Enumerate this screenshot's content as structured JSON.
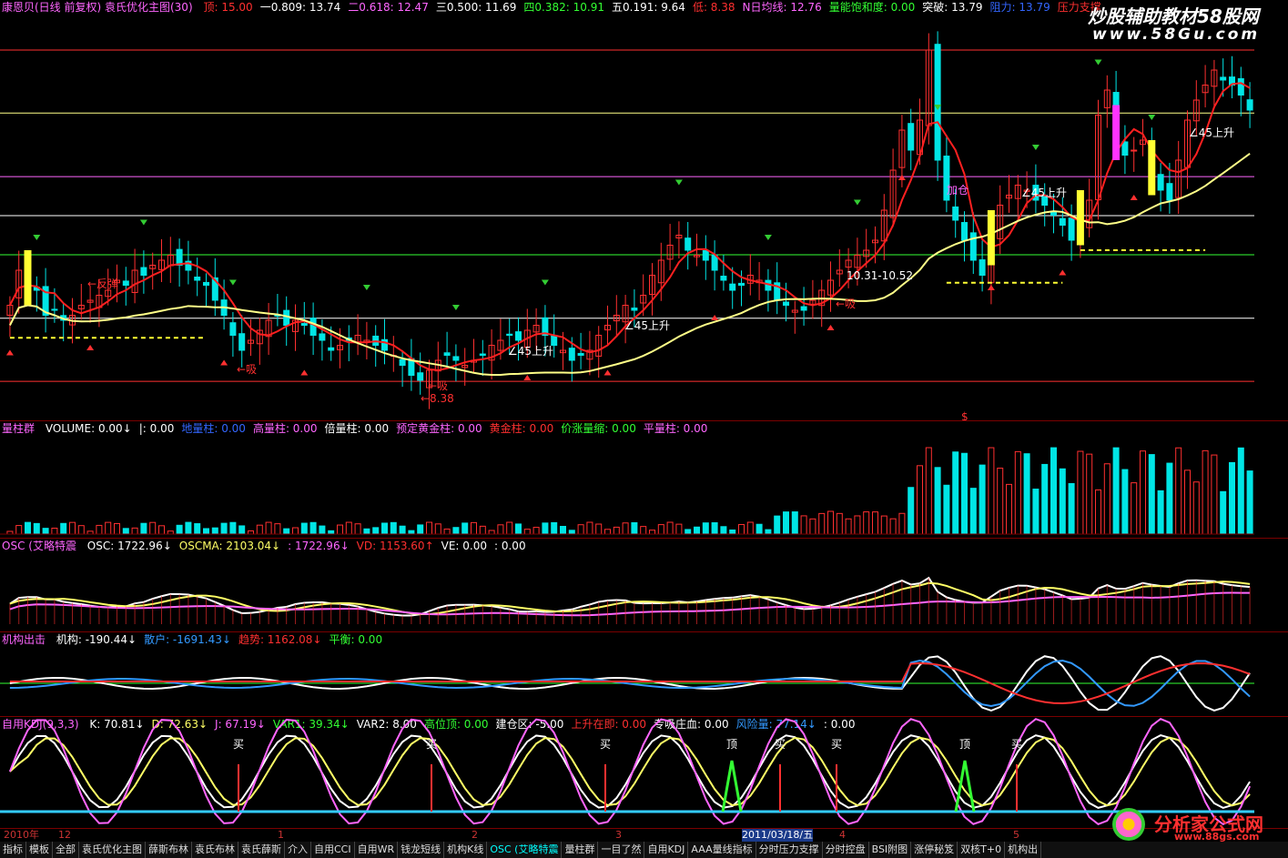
{
  "main_header": {
    "title": "康恩贝(日线 前复权) 袁氏优化主图(30)",
    "items": [
      {
        "t": "顶: 15.00",
        "c": "#ff3030"
      },
      {
        "t": "一0.809: 13.74",
        "c": "#ffffff"
      },
      {
        "t": "二0.618: 12.47",
        "c": "#ff66ff"
      },
      {
        "t": "三0.500: 11.69",
        "c": "#ffffff"
      },
      {
        "t": "四0.382: 10.91",
        "c": "#33ff33"
      },
      {
        "t": "五0.191: 9.64",
        "c": "#ffffff"
      },
      {
        "t": "低: 8.38",
        "c": "#ff3030"
      },
      {
        "t": "N日均线: 12.76",
        "c": "#ff66ff"
      },
      {
        "t": "量能饱和度: 0.00",
        "c": "#33ff33"
      },
      {
        "t": "突破: 13.79",
        "c": "#ffffff"
      },
      {
        "t": "阻力: 13.79",
        "c": "#3366ff"
      },
      {
        "t": "压力支撑",
        "c": "#ff3030"
      }
    ]
  },
  "watermarks": {
    "top": "炒股辅助教材58股网",
    "top_url": "www.58Gu.com",
    "bottom": "分析家公式网",
    "bottom_url": "www.88gs.com"
  },
  "price_labels": {
    "fanstan": "←反弹",
    "xi": "←吸",
    "xi2": "←吸",
    "xi3": "←吸",
    "low": "←8.38",
    "up45": "∠45上升",
    "jiacang": "加仓",
    "fib": "10.31-10.52",
    "dollar": "$"
  },
  "vol_header": {
    "title": "量柱群",
    "items": [
      {
        "t": "VOLUME: 0.00↓",
        "c": "#ffffff"
      },
      {
        "t": "|: 0.00",
        "c": "#ffffff"
      },
      {
        "t": "地量柱: 0.00",
        "c": "#3366ff"
      },
      {
        "t": "高量柱: 0.00",
        "c": "#ff66ff"
      },
      {
        "t": "倍量柱: 0.00",
        "c": "#ffffff"
      },
      {
        "t": "预定黄金柱: 0.00",
        "c": "#ff66ff"
      },
      {
        "t": "黄金柱: 0.00",
        "c": "#ff3030"
      },
      {
        "t": "价涨量缩: 0.00",
        "c": "#33ff33"
      },
      {
        "t": "平量柱: 0.00",
        "c": "#ff66ff"
      }
    ]
  },
  "osc_header": {
    "title": "OSC (艾略特震",
    "items": [
      {
        "t": "OSC: 1722.96↓",
        "c": "#ffffff"
      },
      {
        "t": "OSCMA: 2103.04↓",
        "c": "#ffff66"
      },
      {
        "t": ": 1722.96↓",
        "c": "#ff66ff"
      },
      {
        "t": "VD: 1153.60↑",
        "c": "#ff3030"
      },
      {
        "t": "VE: 0.00",
        "c": "#ffffff"
      },
      {
        "t": ": 0.00",
        "c": "#ffffff"
      }
    ]
  },
  "jg_header": {
    "title": "机构出击",
    "items": [
      {
        "t": "机构: -190.44↓",
        "c": "#ffffff"
      },
      {
        "t": "散户: -1691.43↓",
        "c": "#3399ff"
      },
      {
        "t": "趋势: 1162.08↓",
        "c": "#ff3030"
      },
      {
        "t": "平衡: 0.00",
        "c": "#33ff33"
      }
    ]
  },
  "kdj_header": {
    "title": "自用KDJ(9,3,3)",
    "items": [
      {
        "t": "K: 70.81↓",
        "c": "#ffffff"
      },
      {
        "t": "D: 72.63↓",
        "c": "#ffff66"
      },
      {
        "t": "J: 67.19↓",
        "c": "#ff66ff"
      },
      {
        "t": "VAR1: 39.34↓",
        "c": "#33ff33"
      },
      {
        "t": "VAR2: 8.00",
        "c": "#ffffff"
      },
      {
        "t": "高位顶: 0.00",
        "c": "#33ff33"
      },
      {
        "t": "建仓区: -5.00",
        "c": "#ffffff"
      },
      {
        "t": "上升在即: 0.00",
        "c": "#ff3030"
      },
      {
        "t": "专吸庄血: 0.00",
        "c": "#ffffff"
      },
      {
        "t": "风险量: 77.14↓",
        "c": "#3399ff"
      },
      {
        "t": ": 0.00",
        "c": "#ffffff"
      }
    ],
    "buy": "买",
    "top": "顶"
  },
  "ruler": {
    "ticks": [
      "2010年",
      "12",
      "1",
      "2",
      "3",
      "2011/03/18/五",
      "4",
      "5"
    ]
  },
  "tabs": [
    "指标",
    "模板",
    "全部",
    "袁氏优化主图",
    "薛斯布林",
    "袁氏布林",
    "袁氏薛斯",
    "介入",
    "自用CCI",
    "自用WR",
    "钱龙短线",
    "机构K线",
    "OSC (艾略特震",
    "量柱群",
    "一目了然",
    "自用KDJ",
    "AAA量线指标",
    "分时压力支撑",
    "分时控盘",
    "BSI附图",
    "涨停秘笈",
    "双核T+0",
    "机构出"
  ],
  "chart_data": {
    "type": "candlestick",
    "price_levels": {
      "top": 15.0,
      "l809": 13.74,
      "l618": 12.47,
      "l500": 11.69,
      "l382": 10.91,
      "l191": 9.64,
      "low": 8.38
    },
    "colors": {
      "up": "#ff3030",
      "down": "#00e5e5",
      "ma_fast": "#ff2020",
      "ma_slow": "#ffff88"
    },
    "closes": [
      9.9,
      10.6,
      10.4,
      10.2,
      9.7,
      9.8,
      9.6,
      9.7,
      9.9,
      10.0,
      10.1,
      10.2,
      10.4,
      10.3,
      10.6,
      10.5,
      10.7,
      10.8,
      10.9,
      10.7,
      10.6,
      10.4,
      10.3,
      10.0,
      9.7,
      9.3,
      9.0,
      9.2,
      9.4,
      9.6,
      9.7,
      9.5,
      9.6,
      9.5,
      9.3,
      9.2,
      9.0,
      9.1,
      9.2,
      9.3,
      9.2,
      9.1,
      9.0,
      8.9,
      8.7,
      8.5,
      8.4,
      8.6,
      8.8,
      8.9,
      8.8,
      8.7,
      8.8,
      8.9,
      9.1,
      9.2,
      9.3,
      9.2,
      9.4,
      9.5,
      9.3,
      9.1,
      9.0,
      8.8,
      8.9,
      9.0,
      9.3,
      9.5,
      9.7,
      9.9,
      9.8,
      10.1,
      10.5,
      10.8,
      11.1,
      11.3,
      11.0,
      10.9,
      10.8,
      10.6,
      10.4,
      10.2,
      10.3,
      10.5,
      10.4,
      10.2,
      10.0,
      9.9,
      9.8,
      9.8,
      10.0,
      10.2,
      10.4,
      10.6,
      10.8,
      10.9,
      11.0,
      11.2,
      11.8,
      12.6,
      13.4,
      13.0,
      13.6,
      15.0,
      12.8,
      12.0,
      11.6,
      11.2,
      10.8,
      10.5,
      11.2,
      11.9,
      12.1,
      12.3,
      12.2,
      12.0,
      11.9,
      11.7,
      11.5,
      11.2,
      11.6,
      12.0,
      13.7,
      14.2,
      13.3,
      12.9,
      13.0,
      13.2,
      12.6,
      12.2,
      12.0,
      12.8,
      13.6,
      14.0,
      14.3,
      14.6,
      14.4,
      14.3,
      14.1,
      13.8
    ]
  }
}
